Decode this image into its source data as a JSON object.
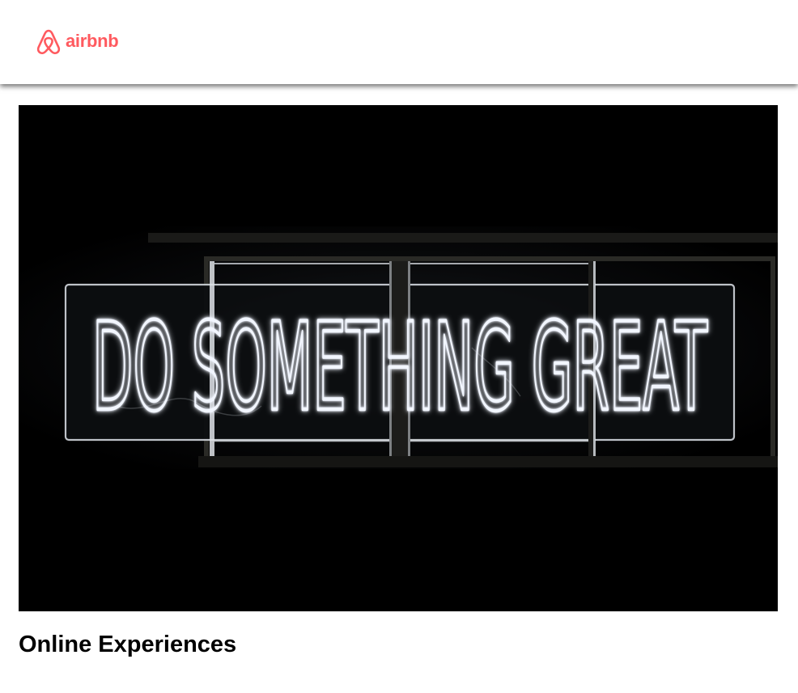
{
  "brand": {
    "name": "airbnb",
    "color": "#ff5a5f",
    "icon": "airbnb-belo-icon"
  },
  "hero": {
    "image_alt": "Neon sign reading DO SOMETHING GREAT",
    "neon_text": "DO SOMETHING GREAT",
    "neon_color": "#f2f6ff"
  },
  "card": {
    "title": "Online Experiences"
  }
}
